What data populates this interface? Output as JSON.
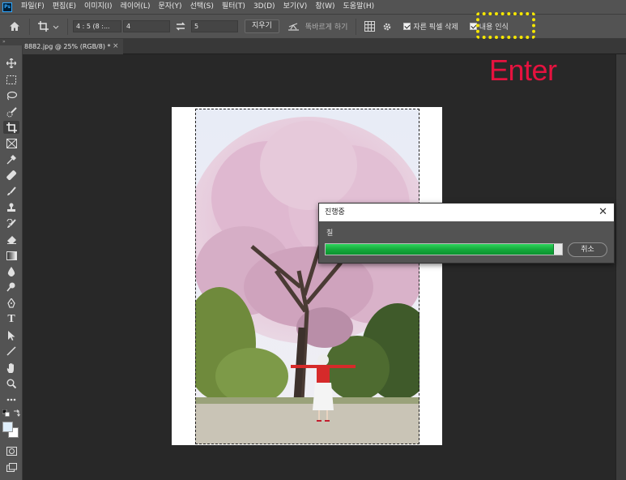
{
  "app": {
    "logo": "Ps"
  },
  "menu": {
    "items": [
      "파일(F)",
      "편집(E)",
      "이미지(I)",
      "레이어(L)",
      "문자(Y)",
      "선택(S)",
      "필터(T)",
      "3D(D)",
      "보기(V)",
      "창(W)",
      "도움말(H)"
    ]
  },
  "options": {
    "ratio_preset": "4 : 5 (8 :...",
    "width_value": "4",
    "height_value": "5",
    "clear_label": "지우기",
    "straighten_label": "똑바르게 하기",
    "delete_pixels_label": "자른 픽셀 삭제",
    "content_aware_label": "내용 인식"
  },
  "document": {
    "tab_title": "8882.jpg @ 25% (RGB/8) *",
    "tab_close": "×"
  },
  "tools_panel": {
    "collapse_glyph": "»"
  },
  "dialog": {
    "title": "진행중",
    "status": "칠",
    "progress": 0.965,
    "cancel_label": "취소",
    "close_glyph": "✕"
  },
  "annotation": {
    "text": "Enter",
    "color": "#e6123f",
    "highlight_color": "#f5e600"
  },
  "colors": {
    "progress_green": "#14a83a",
    "chrome": "#535353",
    "workspace": "#282828"
  }
}
